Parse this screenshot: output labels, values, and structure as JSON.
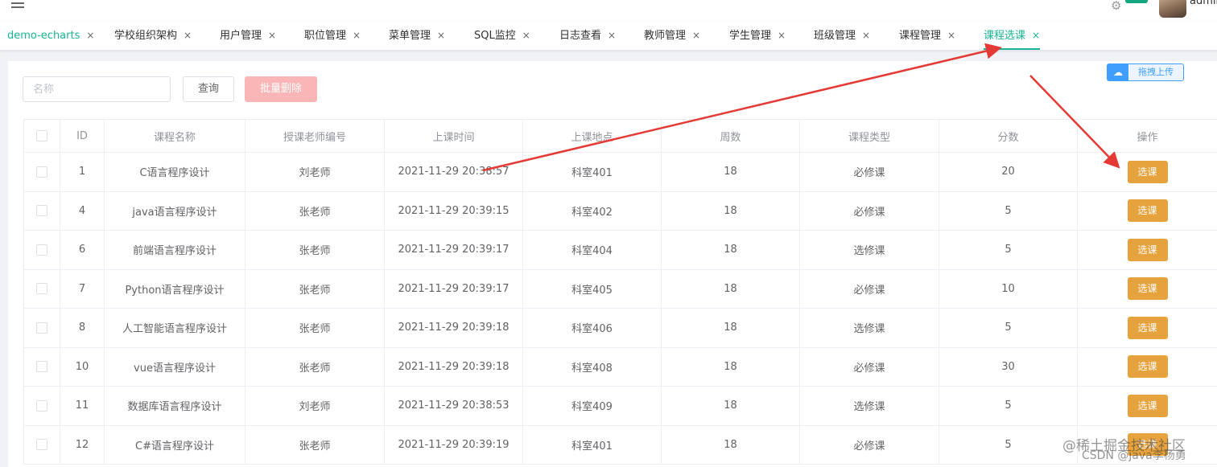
{
  "header": {
    "username": "admin"
  },
  "tabs": [
    {
      "label": "demo-echarts",
      "state": "home"
    },
    {
      "label": "学校组织架构",
      "state": "normal"
    },
    {
      "label": "用户管理",
      "state": "normal"
    },
    {
      "label": "职位管理",
      "state": "normal"
    },
    {
      "label": "菜单管理",
      "state": "normal"
    },
    {
      "label": "SQL监控",
      "state": "normal"
    },
    {
      "label": "日志查看",
      "state": "normal"
    },
    {
      "label": "教师管理",
      "state": "normal"
    },
    {
      "label": "学生管理",
      "state": "normal"
    },
    {
      "label": "班级管理",
      "state": "normal"
    },
    {
      "label": "课程管理",
      "state": "normal"
    },
    {
      "label": "课程选课",
      "state": "active"
    }
  ],
  "tab_close_glyph": "×",
  "toolbar": {
    "search_placeholder": "名称",
    "query_label": "查询",
    "batch_delete_label": "批量删除",
    "upload_label": "拖拽上传"
  },
  "table": {
    "columns": [
      "ID",
      "课程名称",
      "授课老师编号",
      "上课时间",
      "上课地点",
      "周数",
      "课程类型",
      "分数",
      "操作"
    ],
    "action_label": "选课",
    "rows": [
      {
        "id": "1",
        "name": "C语言程序设计",
        "teacher": "刘老师",
        "time": "2021-11-29 20:38:57",
        "place": "科室401",
        "weeks": "18",
        "type": "必修课",
        "score": "20"
      },
      {
        "id": "4",
        "name": "java语言程序设计",
        "teacher": "张老师",
        "time": "2021-11-29 20:39:15",
        "place": "科室402",
        "weeks": "18",
        "type": "必修课",
        "score": "5"
      },
      {
        "id": "6",
        "name": "前端语言程序设计",
        "teacher": "张老师",
        "time": "2021-11-29 20:39:17",
        "place": "科室404",
        "weeks": "18",
        "type": "选修课",
        "score": "5"
      },
      {
        "id": "7",
        "name": "Python语言程序设计",
        "teacher": "张老师",
        "time": "2021-11-29 20:39:17",
        "place": "科室405",
        "weeks": "18",
        "type": "必修课",
        "score": "10"
      },
      {
        "id": "8",
        "name": "人工智能语言程序设计",
        "teacher": "张老师",
        "time": "2021-11-29 20:39:18",
        "place": "科室406",
        "weeks": "18",
        "type": "选修课",
        "score": "5"
      },
      {
        "id": "10",
        "name": "vue语言程序设计",
        "teacher": "张老师",
        "time": "2021-11-29 20:39:18",
        "place": "科室408",
        "weeks": "18",
        "type": "必修课",
        "score": "30"
      },
      {
        "id": "11",
        "name": "数据库语言程序设计",
        "teacher": "刘老师",
        "time": "2021-11-29 20:38:53",
        "place": "科室409",
        "weeks": "18",
        "type": "选修课",
        "score": "5"
      },
      {
        "id": "12",
        "name": "C#语言程序设计",
        "teacher": "张老师",
        "time": "2021-11-29 20:39:19",
        "place": "科室401",
        "weeks": "18",
        "type": "必修课",
        "score": "5"
      }
    ]
  },
  "watermark": {
    "line1": "@稀土掘金技术社区",
    "line2": "CSDN @java李杨勇"
  },
  "colors": {
    "accent": "#1ab394",
    "warning": "#e6a23c",
    "danger_light": "#fab6b6",
    "arrow": "#e53935"
  }
}
